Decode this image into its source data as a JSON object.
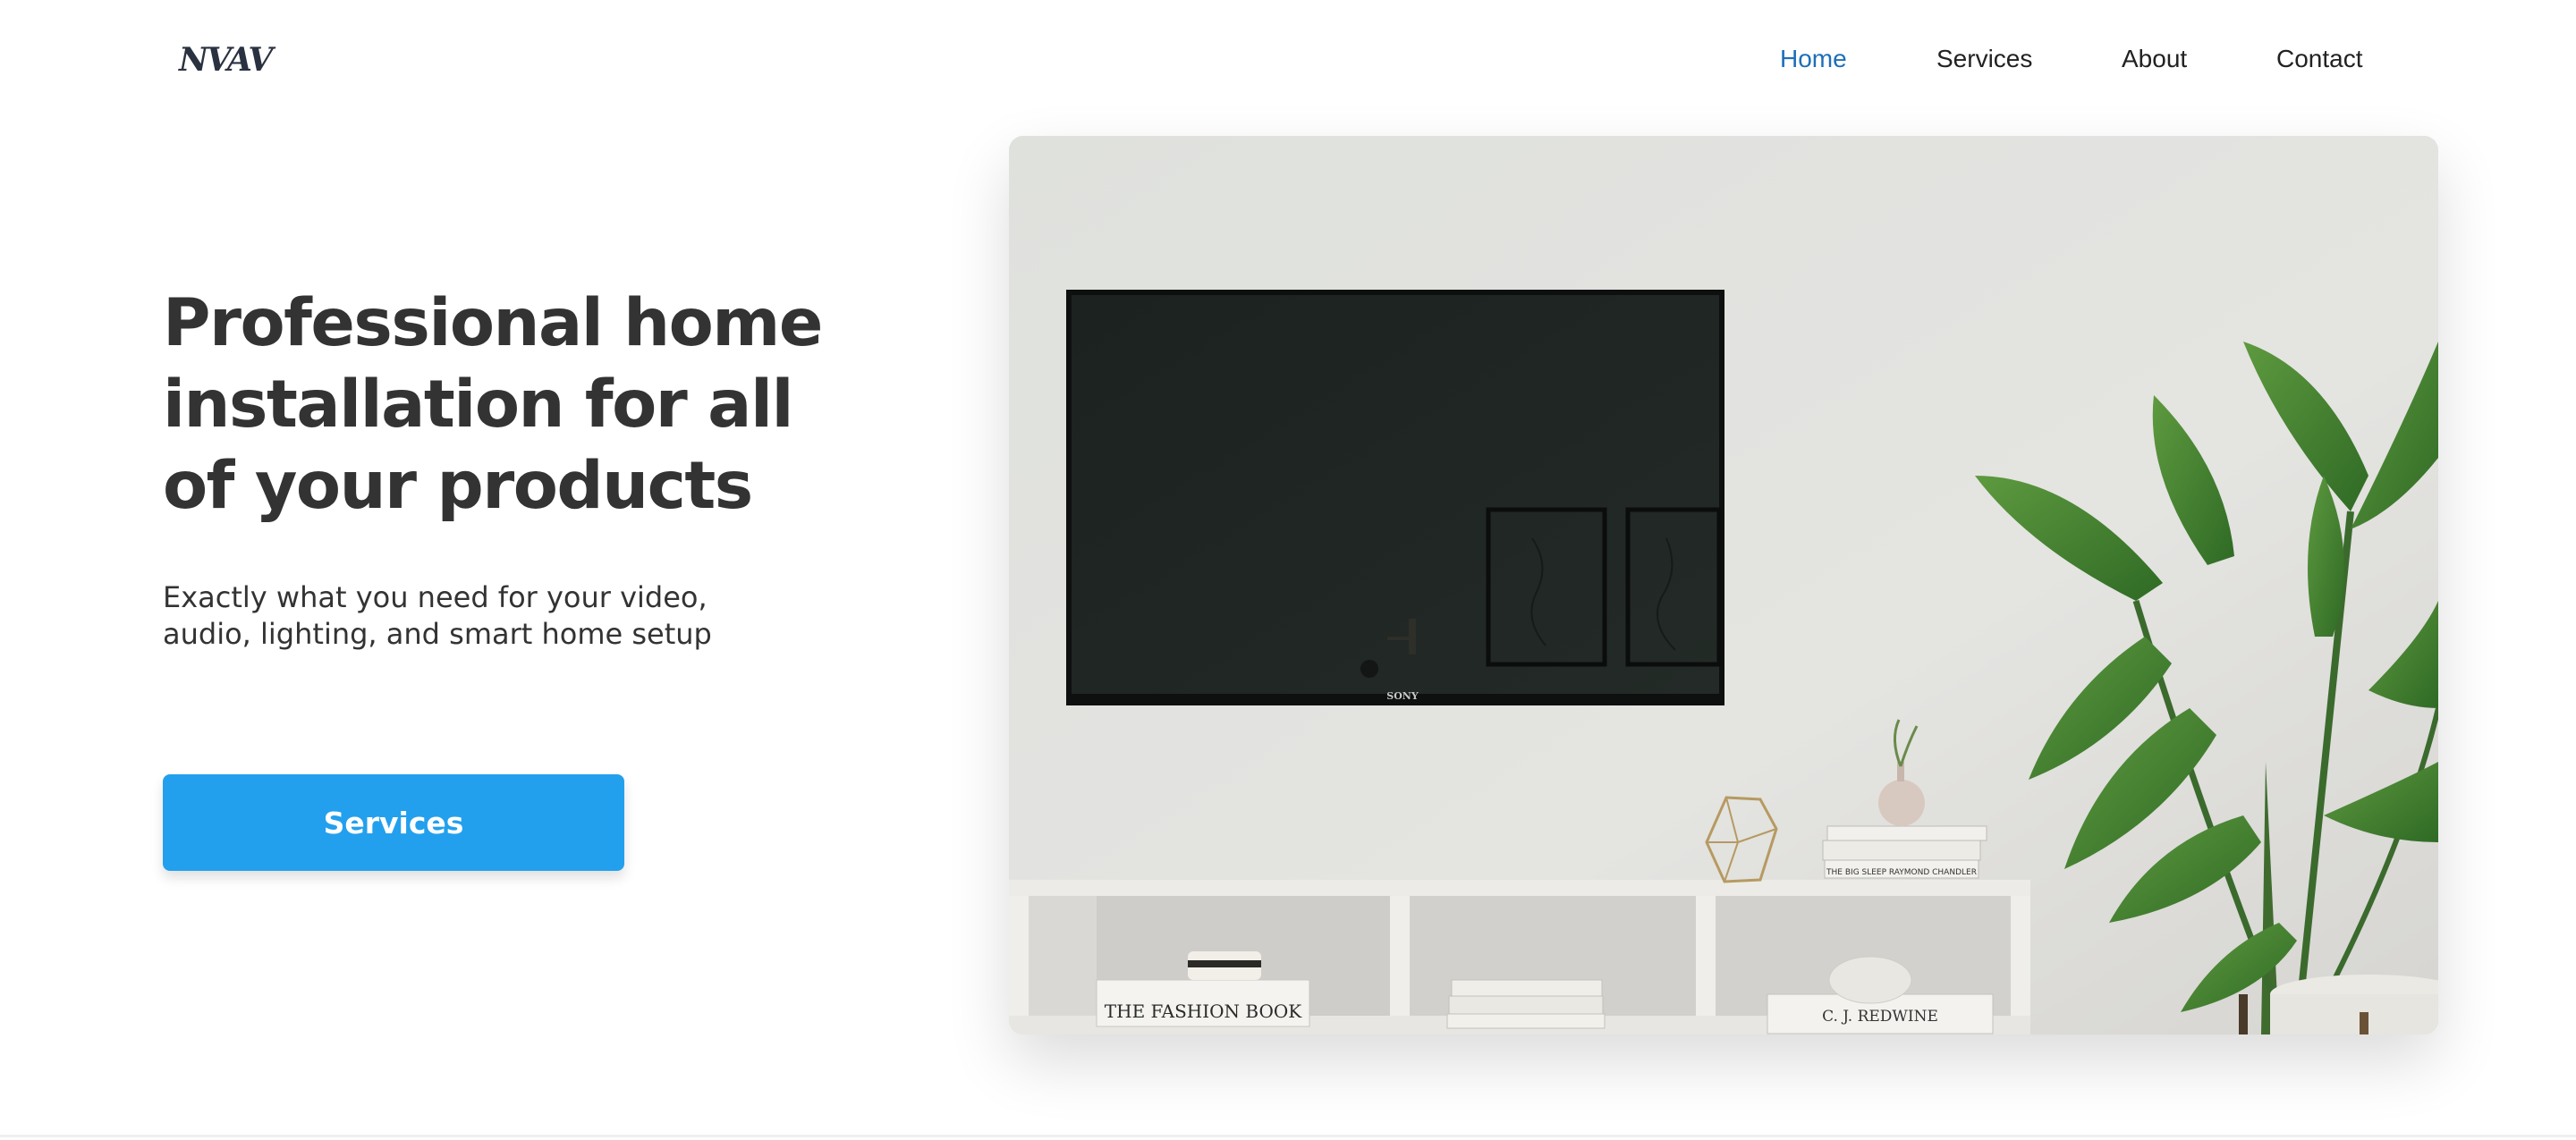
{
  "header": {
    "logo": "NVAV",
    "nav": [
      {
        "label": "Home",
        "active": true
      },
      {
        "label": "Services",
        "active": false
      },
      {
        "label": "About",
        "active": false
      },
      {
        "label": "Contact",
        "active": false
      }
    ]
  },
  "hero": {
    "title": "Professional home installation for all of your products",
    "subtitle": "Exactly what you need for your video, audio, lighting, and smart home setup",
    "cta_label": "Services",
    "image": {
      "tv_brand": "SONY",
      "book_fashion": "THE FASHION BOOK",
      "book_redwine": "C. J. REDWINE",
      "book_big_sleep": "THE BIG SLEEP  RAYMOND CHANDLER"
    }
  },
  "colors": {
    "accent": "#23a0ed",
    "nav_active": "#1d6fb8",
    "text": "#333333"
  }
}
